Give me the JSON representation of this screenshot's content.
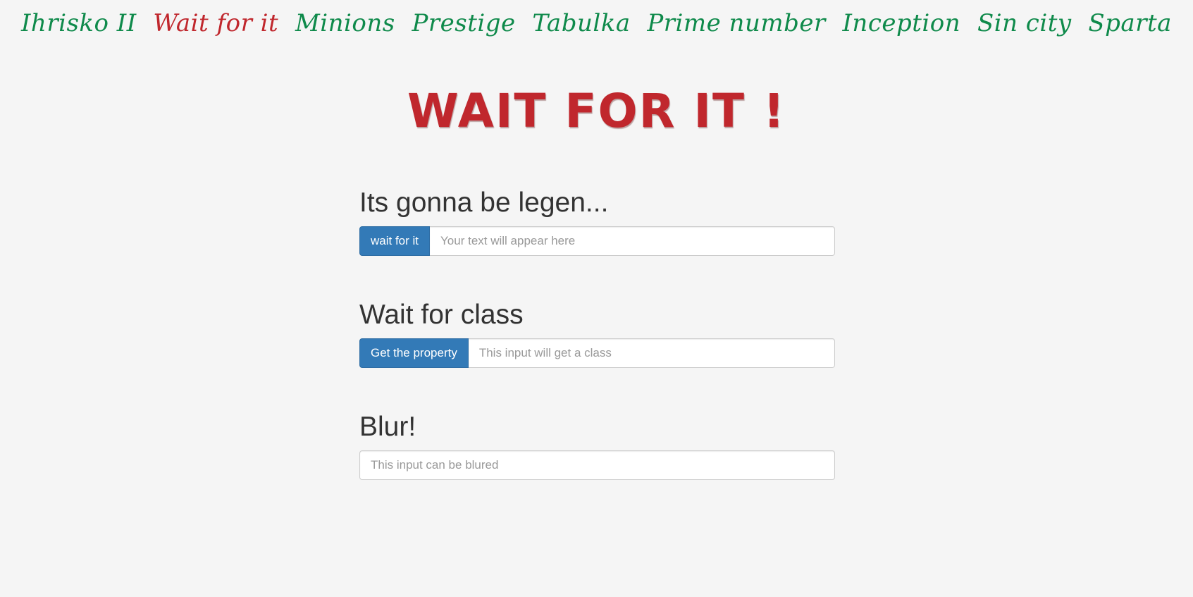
{
  "nav": {
    "items": [
      {
        "label": "Ihrisko II",
        "active": false
      },
      {
        "label": "Wait for it",
        "active": true
      },
      {
        "label": "Minions",
        "active": false
      },
      {
        "label": "Prestige",
        "active": false
      },
      {
        "label": "Tabulka",
        "active": false
      },
      {
        "label": "Prime number",
        "active": false
      },
      {
        "label": "Inception",
        "active": false
      },
      {
        "label": "Sin city",
        "active": false
      },
      {
        "label": "Sparta",
        "active": false
      }
    ],
    "colors": {
      "default": "#0f8a4b",
      "active": "#c0272d"
    }
  },
  "page": {
    "title": "WAIT FOR IT !"
  },
  "sections": [
    {
      "heading": "Its gonna be legen...",
      "button_label": "wait for it",
      "input_placeholder": "Your text will appear here",
      "input_value": ""
    },
    {
      "heading": "Wait for class",
      "button_label": "Get the property",
      "input_placeholder": "This input will get a class",
      "input_value": ""
    },
    {
      "heading": "Blur!",
      "input_placeholder": "This input can be blured",
      "input_value": ""
    }
  ],
  "colors": {
    "background": "#f5f5f5",
    "button": "#337ab7",
    "title": "#c0272d"
  }
}
